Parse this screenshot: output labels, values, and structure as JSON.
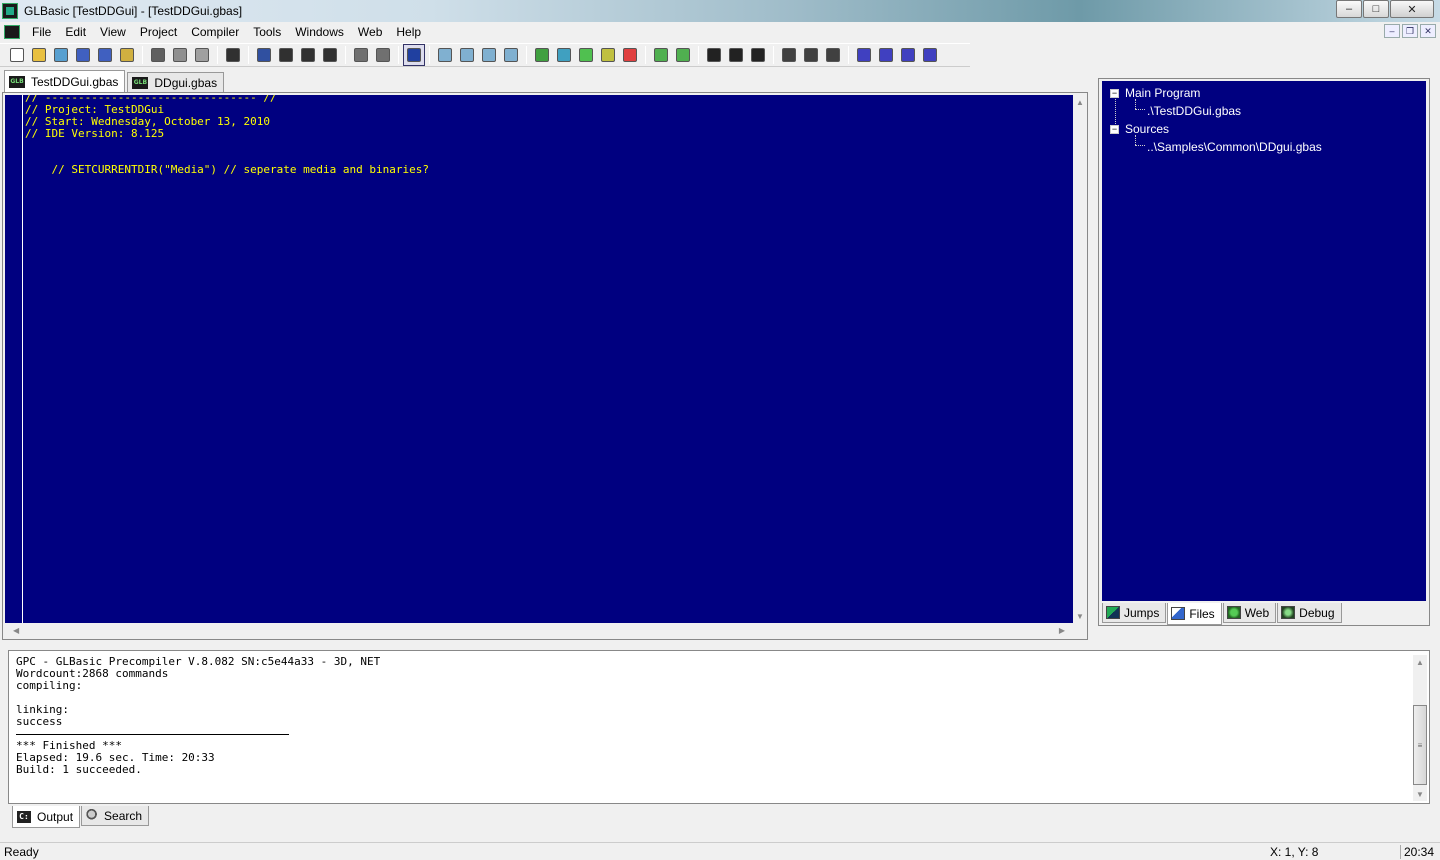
{
  "window": {
    "title": "GLBasic [TestDDGui] - [TestDDGui.gbas]",
    "controls": [
      "minimize",
      "maximize",
      "close"
    ],
    "control_glyphs": {
      "minimize": "–",
      "maximize": "□",
      "close": "✕"
    }
  },
  "menu": {
    "items": [
      "File",
      "Edit",
      "View",
      "Project",
      "Compiler",
      "Tools",
      "Windows",
      "Web",
      "Help"
    ],
    "mdi_glyphs": {
      "minimize": "–",
      "restore": "❐",
      "close": "✕"
    }
  },
  "toolbar": {
    "buttons": [
      {
        "icon": "new-file-icon",
        "color": "#ffffff"
      },
      {
        "icon": "open-folder-icon",
        "color": "#e8c040"
      },
      {
        "icon": "open-project-icon",
        "color": "#58a0d0"
      },
      {
        "icon": "save-icon",
        "color": "#4060c0"
      },
      {
        "icon": "save-all-icon",
        "color": "#4060c0"
      },
      {
        "icon": "export-icon",
        "color": "#d0b040"
      },
      {
        "sep": true
      },
      {
        "icon": "cut-icon",
        "color": "#606060"
      },
      {
        "icon": "copy-icon",
        "color": "#909090"
      },
      {
        "icon": "paste-icon",
        "color": "#a0a0a0"
      },
      {
        "sep": true
      },
      {
        "icon": "list-icon",
        "color": "#303030"
      },
      {
        "sep": true
      },
      {
        "icon": "bookmark-icon",
        "color": "#3050a0"
      },
      {
        "icon": "bookmark-next-icon",
        "color": "#303030"
      },
      {
        "icon": "bookmark-prev-icon",
        "color": "#303030"
      },
      {
        "icon": "bookmark-clear-icon",
        "color": "#303030"
      },
      {
        "sep": true
      },
      {
        "icon": "indent-icon",
        "color": "#707070"
      },
      {
        "icon": "outdent-icon",
        "color": "#707070"
      },
      {
        "sep": true
      },
      {
        "icon": "editor-view-icon",
        "color": "#2040a0",
        "active": true
      },
      {
        "sep": true
      },
      {
        "icon": "find-icon",
        "color": "#80b0d0"
      },
      {
        "icon": "find-next-icon",
        "color": "#80b0d0"
      },
      {
        "icon": "find-prev-icon",
        "color": "#80b0d0"
      },
      {
        "icon": "replace-icon",
        "color": "#80b0d0"
      },
      {
        "sep": true
      },
      {
        "icon": "compile-icon",
        "color": "#40a040"
      },
      {
        "icon": "build-icon",
        "color": "#40a0c0"
      },
      {
        "icon": "run-icon",
        "color": "#50c050"
      },
      {
        "icon": "debug-icon",
        "color": "#c0c040"
      },
      {
        "icon": "stop-icon",
        "color": "#e04040"
      },
      {
        "sep": true
      },
      {
        "icon": "sub-icon",
        "color": "#50b050"
      },
      {
        "icon": "function-icon",
        "color": "#50b050"
      },
      {
        "sep": true
      },
      {
        "icon": "play-icon",
        "color": "#222222"
      },
      {
        "icon": "pause-icon",
        "color": "#222222"
      },
      {
        "icon": "stop-square-icon",
        "color": "#222222"
      },
      {
        "sep": true
      },
      {
        "icon": "step-into-icon",
        "color": "#404040"
      },
      {
        "icon": "step-over-icon",
        "color": "#404040"
      },
      {
        "icon": "step-out-icon",
        "color": "#404040"
      },
      {
        "sep": true
      },
      {
        "icon": "watch-add-icon",
        "color": "#4040c0"
      },
      {
        "icon": "watch-remove-icon",
        "color": "#4040c0"
      },
      {
        "icon": "watch-edit-icon",
        "color": "#4040c0"
      },
      {
        "icon": "watch-clear-icon",
        "color": "#4040c0"
      }
    ]
  },
  "editor": {
    "tabs": [
      {
        "label": "TestDDGui.gbas",
        "active": true
      },
      {
        "label": "DDgui.gbas",
        "active": false
      }
    ],
    "lines": [
      "// -------------------------------- //",
      "// Project: TestDDGui",
      "// Start: Wednesday, October 13, 2010",
      "// IDE Version: 8.125",
      "",
      "",
      "    // SETCURRENTDIR(\"Media\") // seperate media and binaries?"
    ],
    "background": "#000080",
    "text_color": "#ffff00"
  },
  "side_panel": {
    "tree": {
      "groups": [
        {
          "label": "Main Program",
          "children": [
            ".\\TestDDGui.gbas"
          ]
        },
        {
          "label": "Sources",
          "children": [
            "..\\Samples\\Common\\DDgui.gbas"
          ]
        }
      ]
    },
    "tabs": [
      {
        "label": "Jumps",
        "active": false
      },
      {
        "label": "Files",
        "active": true
      },
      {
        "label": "Web",
        "active": false
      },
      {
        "label": "Debug",
        "active": false
      }
    ]
  },
  "output": {
    "lines": [
      "GPC - GLBasic Precompiler V.8.082 SN:c5e44a33 - 3D, NET",
      "Wordcount:2868 commands",
      "compiling:",
      "",
      "linking:",
      "success",
      "",
      "*** Finished ***",
      "Elapsed: 19.6 sec. Time: 20:33",
      "Build: 1 succeeded."
    ],
    "tabs": [
      {
        "label": "Output",
        "active": true
      },
      {
        "label": "Search",
        "active": false
      }
    ]
  },
  "statusbar": {
    "status": "Ready",
    "cursor": "X:  1, Y:  8",
    "clock": "20:34"
  }
}
